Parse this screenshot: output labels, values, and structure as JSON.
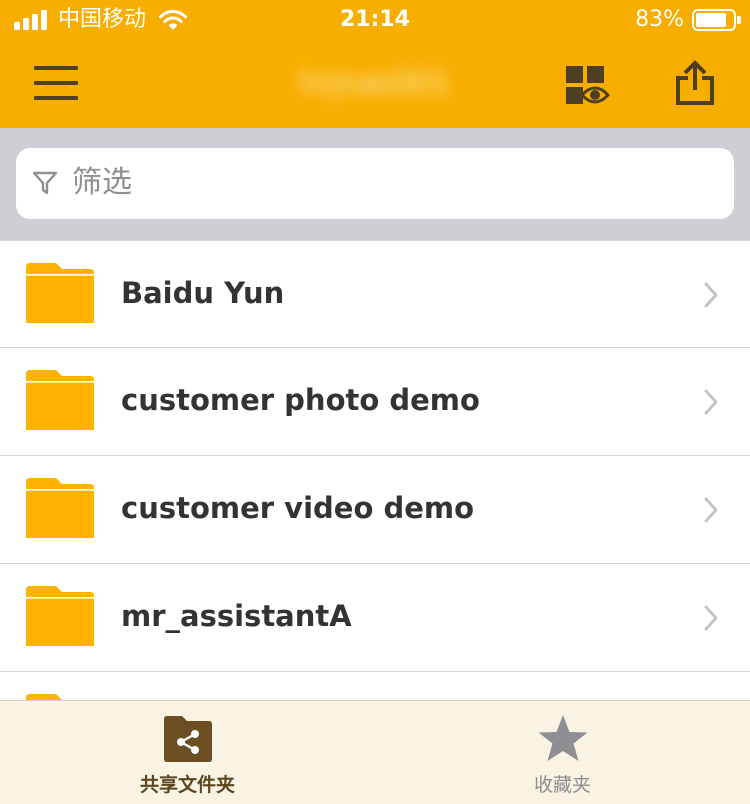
{
  "status_bar": {
    "carrier": "中国移动",
    "time": "21:14",
    "battery_percent": "83%",
    "battery_level": 0.83
  },
  "nav": {
    "title": "hrjnas001",
    "menu_icon": "hamburger-menu-icon",
    "view_icon": "grid-view-eye-icon",
    "share_icon": "share-export-icon"
  },
  "filter": {
    "placeholder": "筛选",
    "icon": "filter-funnel-icon"
  },
  "folders": [
    {
      "name": "Baidu Yun"
    },
    {
      "name": "customer photo demo"
    },
    {
      "name": "customer video demo"
    },
    {
      "name": "mr_assistantA"
    }
  ],
  "tabs": [
    {
      "label": "共享文件夹",
      "icon": "shared-folder-icon",
      "active": true
    },
    {
      "label": "收藏夹",
      "icon": "star-icon",
      "active": false
    }
  ],
  "colors": {
    "accent": "#f7ae00",
    "folder": "#ffb300",
    "tab_active": "#5c4620",
    "tab_inactive": "#8e8e93"
  }
}
